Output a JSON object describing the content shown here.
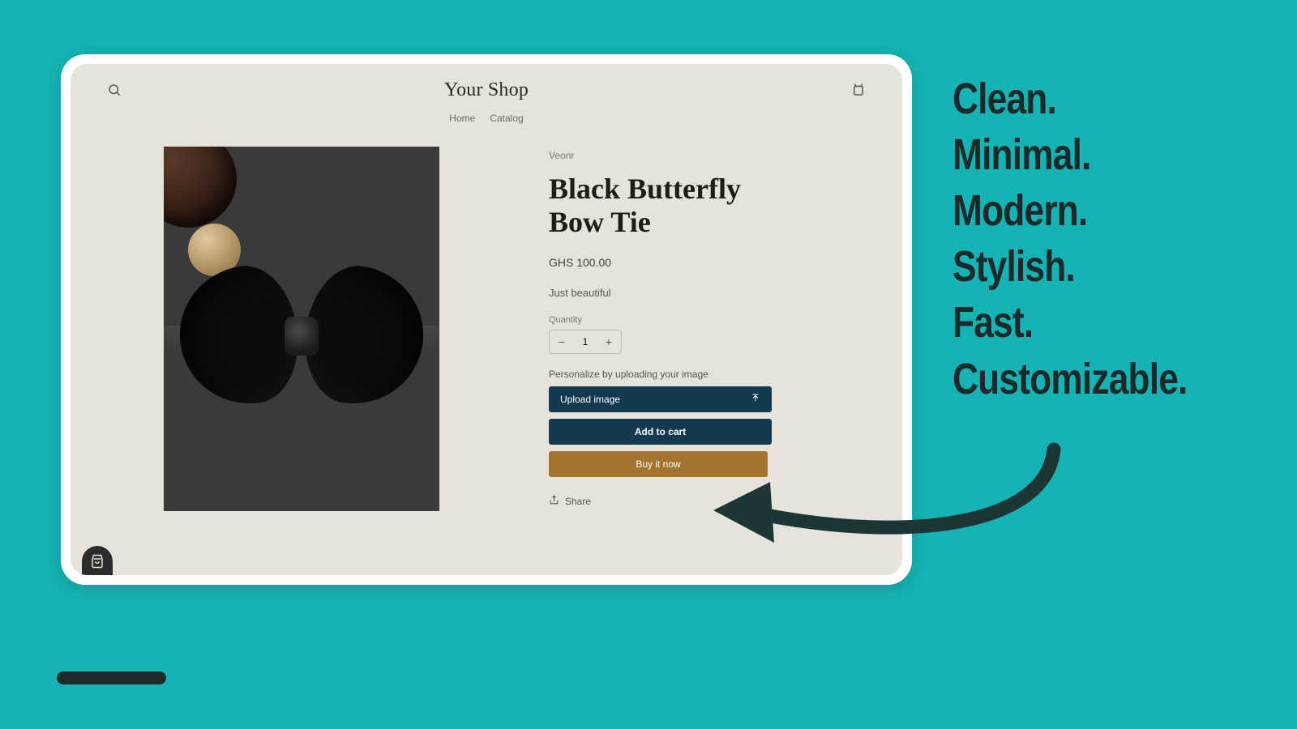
{
  "header": {
    "shop_name": "Your Shop",
    "nav": {
      "home": "Home",
      "catalog": "Catalog"
    }
  },
  "product": {
    "vendor": "Veonr",
    "title": "Black Butterfly Bow Tie",
    "price": "GHS 100.00",
    "description": "Just beautiful",
    "quantity_label": "Quantity",
    "quantity_value": "1",
    "personalize_label": "Personalize by uploading your image",
    "upload_label": "Upload image",
    "add_to_cart_label": "Add to cart",
    "buy_now_label": "Buy it now",
    "share_label": "Share"
  },
  "marketing": {
    "lines": "Clean.\nMinimal.\nModern.\nStylish.\nFast.\nCustomizable."
  }
}
